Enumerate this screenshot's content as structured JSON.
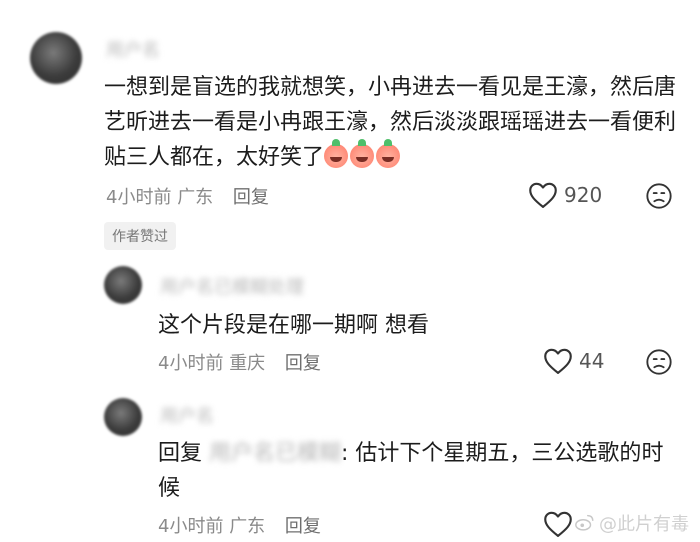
{
  "comments": [
    {
      "username": "用户名",
      "text": "一想到是盲选的我就想笑，小冉进去一看见是王濠，然后唐艺昕进去一看是小冉跟王濠，然后淡淡跟瑶瑶进去一看便利贴三人都在，太好笑了",
      "time": "4小时前",
      "location": "广东",
      "reply_label": "回复",
      "likes": "920",
      "badge": "作者赞过"
    },
    {
      "username": "用户名已模糊处理",
      "text": "这个片段是在哪一期啊 想看",
      "time": "4小时前",
      "location": "重庆",
      "reply_label": "回复",
      "likes": "44"
    },
    {
      "username": "用户名",
      "reply_prefix": "回复",
      "reply_to": "用户名已模糊",
      "text": ": 估计下个星期五，三公选歌的时候",
      "time": "4小时前",
      "location": "广东",
      "reply_label": "回复"
    }
  ],
  "watermark": "@此片有毒"
}
